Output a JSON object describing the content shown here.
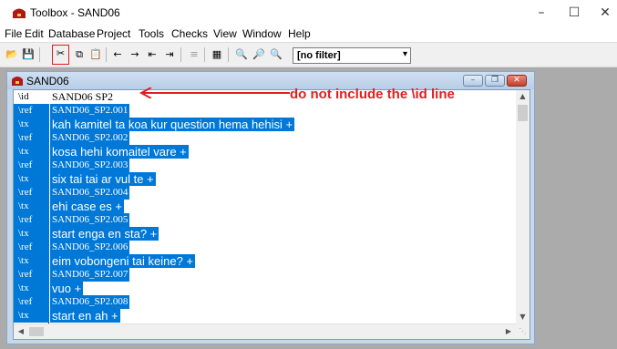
{
  "window": {
    "title": "Toolbox - SAND06"
  },
  "menu": [
    "File",
    "Edit",
    "Database",
    "Project",
    "Tools",
    "Checks",
    "View",
    "Window",
    "Help"
  ],
  "toolbar": {
    "filter_value": "[no filter]"
  },
  "document": {
    "title": "SAND06",
    "rows": [
      {
        "marker": "\\id",
        "text": "SAND06 SP2",
        "kind": "id",
        "selected": false
      },
      {
        "marker": "\\ref",
        "text": "SAND06_SP2.001",
        "kind": "ref",
        "selected": true
      },
      {
        "marker": "\\tx",
        "text": "kah kamitel ta koa kur question hema hehisi +",
        "kind": "tx",
        "selected": true
      },
      {
        "marker": "\\ref",
        "text": "SAND06_SP2.002",
        "kind": "ref",
        "selected": true
      },
      {
        "marker": "\\tx",
        "text": "kosa hehi komaitel vare +",
        "kind": "tx",
        "selected": true
      },
      {
        "marker": "\\ref",
        "text": "SAND06_SP2.003",
        "kind": "ref",
        "selected": true
      },
      {
        "marker": "\\tx",
        "text": "six tai tai ar vul te +",
        "kind": "tx",
        "selected": true
      },
      {
        "marker": "\\ref",
        "text": "SAND06_SP2.004",
        "kind": "ref",
        "selected": true
      },
      {
        "marker": "\\tx",
        "text": "ehi case es +",
        "kind": "tx",
        "selected": true
      },
      {
        "marker": "\\ref",
        "text": "SAND06_SP2.005",
        "kind": "ref",
        "selected": true
      },
      {
        "marker": "\\tx",
        "text": "start enga en sta? +",
        "kind": "tx",
        "selected": true
      },
      {
        "marker": "\\ref",
        "text": "SAND06_SP2.006",
        "kind": "ref",
        "selected": true
      },
      {
        "marker": "\\tx",
        "text": "eim vobongeni tai keine? +",
        "kind": "tx",
        "selected": true
      },
      {
        "marker": "\\ref",
        "text": "SAND06_SP2.007",
        "kind": "ref",
        "selected": true
      },
      {
        "marker": "\\tx",
        "text": "vuo +",
        "kind": "tx",
        "selected": true
      },
      {
        "marker": "\\ref",
        "text": "SAND06_SP2.008",
        "kind": "ref",
        "selected": true
      },
      {
        "marker": "\\tx",
        "text": "start en ah +",
        "kind": "tx",
        "selected": true
      }
    ]
  },
  "annotation": {
    "text": "do not include the \\id line",
    "color": "#e02020"
  },
  "colors": {
    "selection": "#0078d7",
    "annotation": "#e02020"
  }
}
